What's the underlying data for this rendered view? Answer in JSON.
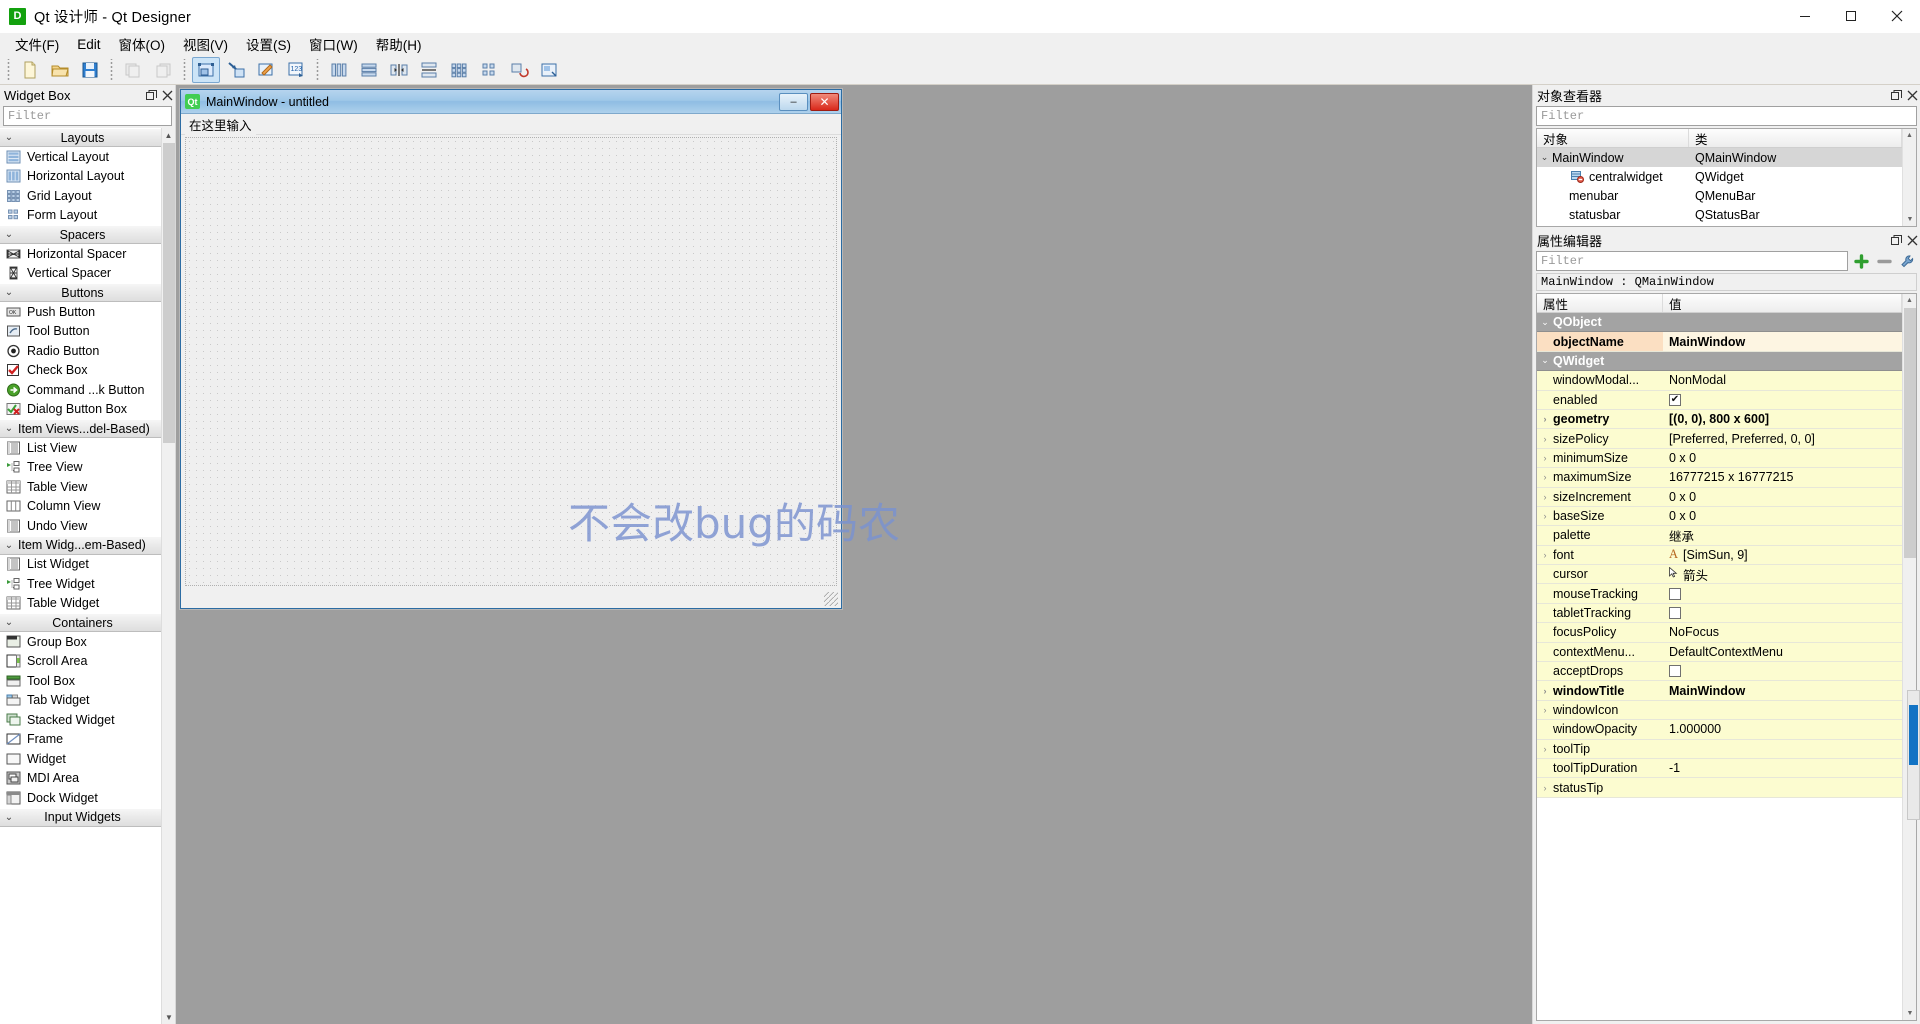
{
  "window": {
    "title": "Qt 设计师 - Qt Designer",
    "app_icon": "D",
    "minimize": "minimize-icon",
    "maximize": "maximize-icon",
    "close": "close-icon"
  },
  "menubar": {
    "items": [
      {
        "label": "文件(F)",
        "mnemonic": "F"
      },
      {
        "label": "Edit",
        "mnemonic": "E"
      },
      {
        "label": "窗体(O)",
        "mnemonic": "O"
      },
      {
        "label": "视图(V)",
        "mnemonic": "V"
      },
      {
        "label": "设置(S)",
        "mnemonic": "S"
      },
      {
        "label": "窗口(W)",
        "mnemonic": "W"
      },
      {
        "label": "帮助(H)",
        "mnemonic": "H"
      }
    ]
  },
  "toolbar": {
    "groups": [
      {
        "name": "file",
        "buttons": [
          {
            "name": "new-form-button",
            "icon": "new-document-icon",
            "state": "enabled"
          },
          {
            "name": "open-form-button",
            "icon": "open-folder-icon",
            "state": "enabled"
          },
          {
            "name": "save-form-button",
            "icon": "save-disk-icon",
            "state": "enabled"
          }
        ]
      },
      {
        "name": "edit",
        "buttons": [
          {
            "name": "undo-button",
            "icon": "undo-icon",
            "state": "disabled"
          },
          {
            "name": "redo-button",
            "icon": "redo-icon",
            "state": "disabled"
          }
        ]
      },
      {
        "name": "mode",
        "buttons": [
          {
            "name": "edit-widgets-button",
            "icon": "edit-widgets-icon",
            "state": "active"
          },
          {
            "name": "edit-signals-slots-button",
            "icon": "signals-slots-icon",
            "state": "enabled"
          },
          {
            "name": "edit-buddies-button",
            "icon": "edit-buddies-icon",
            "state": "enabled"
          },
          {
            "name": "edit-tab-order-button",
            "icon": "tab-order-icon",
            "state": "enabled"
          }
        ]
      },
      {
        "name": "layout",
        "buttons": [
          {
            "name": "layout-horizontally-button",
            "icon": "layout-horizontal-icon",
            "state": "enabled"
          },
          {
            "name": "layout-vertically-button",
            "icon": "layout-vertical-icon",
            "state": "enabled"
          },
          {
            "name": "layout-splitter-horizontal-button",
            "icon": "splitter-horizontal-icon",
            "state": "enabled"
          },
          {
            "name": "layout-splitter-vertical-button",
            "icon": "splitter-vertical-icon",
            "state": "enabled"
          },
          {
            "name": "layout-grid-button",
            "icon": "layout-grid-icon",
            "state": "enabled"
          },
          {
            "name": "layout-form-button",
            "icon": "layout-form-icon",
            "state": "enabled"
          },
          {
            "name": "break-layout-button",
            "icon": "break-layout-icon",
            "state": "enabled"
          },
          {
            "name": "adjust-size-button",
            "icon": "adjust-size-icon",
            "state": "enabled"
          }
        ]
      }
    ]
  },
  "widget_box": {
    "title": "Widget Box",
    "float_icon": "restore-icon",
    "close_icon": "close-icon",
    "filter_placeholder": "Filter",
    "sections": [
      {
        "label": "Layouts",
        "expanded": true,
        "align": "center",
        "items": [
          {
            "label": "Vertical Layout",
            "icon": "vertical-layout-icon"
          },
          {
            "label": "Horizontal Layout",
            "icon": "horizontal-layout-icon"
          },
          {
            "label": "Grid Layout",
            "icon": "grid-layout-icon"
          },
          {
            "label": "Form Layout",
            "icon": "form-layout-icon"
          }
        ]
      },
      {
        "label": "Spacers",
        "expanded": true,
        "align": "center",
        "items": [
          {
            "label": "Horizontal Spacer",
            "icon": "horizontal-spacer-icon"
          },
          {
            "label": "Vertical Spacer",
            "icon": "vertical-spacer-icon"
          }
        ]
      },
      {
        "label": "Buttons",
        "expanded": true,
        "align": "center",
        "items": [
          {
            "label": "Push Button",
            "icon": "push-button-icon"
          },
          {
            "label": "Tool Button",
            "icon": "tool-button-icon"
          },
          {
            "label": "Radio Button",
            "icon": "radio-button-icon"
          },
          {
            "label": "Check Box",
            "icon": "check-box-icon"
          },
          {
            "label": "Command ...k Button",
            "icon": "command-link-button-icon"
          },
          {
            "label": "Dialog Button Box",
            "icon": "dialog-button-box-icon"
          }
        ]
      },
      {
        "label": "Item Views...del-Based)",
        "expanded": true,
        "align": "left",
        "items": [
          {
            "label": "List View",
            "icon": "list-view-icon"
          },
          {
            "label": "Tree View",
            "icon": "tree-view-icon"
          },
          {
            "label": "Table View",
            "icon": "table-view-icon"
          },
          {
            "label": "Column View",
            "icon": "column-view-icon"
          },
          {
            "label": "Undo View",
            "icon": "undo-view-icon"
          }
        ]
      },
      {
        "label": "Item Widg...em-Based)",
        "expanded": true,
        "align": "left",
        "items": [
          {
            "label": "List Widget",
            "icon": "list-widget-icon"
          },
          {
            "label": "Tree Widget",
            "icon": "tree-widget-icon"
          },
          {
            "label": "Table Widget",
            "icon": "table-widget-icon"
          }
        ]
      },
      {
        "label": "Containers",
        "expanded": true,
        "align": "center",
        "items": [
          {
            "label": "Group Box",
            "icon": "group-box-icon"
          },
          {
            "label": "Scroll Area",
            "icon": "scroll-area-icon"
          },
          {
            "label": "Tool Box",
            "icon": "tool-box-icon"
          },
          {
            "label": "Tab Widget",
            "icon": "tab-widget-icon"
          },
          {
            "label": "Stacked Widget",
            "icon": "stacked-widget-icon"
          },
          {
            "label": "Frame",
            "icon": "frame-icon"
          },
          {
            "label": "Widget",
            "icon": "widget-icon"
          },
          {
            "label": "MDI Area",
            "icon": "mdi-area-icon"
          },
          {
            "label": "Dock Widget",
            "icon": "dock-widget-icon"
          }
        ]
      },
      {
        "label": "Input Widgets",
        "expanded": false,
        "align": "center",
        "items": []
      }
    ]
  },
  "form": {
    "title": "MainWindow - untitled",
    "icon_text": "Qt",
    "minimize_label": "–",
    "close_label": "✕",
    "menu_placeholder": "在这里输入"
  },
  "canvas": {
    "watermark": "不会改bug的码农"
  },
  "object_inspector": {
    "title": "对象查看器",
    "float_icon": "restore-icon",
    "close_icon": "close-icon",
    "filter_placeholder": "Filter",
    "columns": [
      "对象",
      "类"
    ],
    "rows": [
      {
        "name": "MainWindow",
        "class": "QMainWindow",
        "indent": 0,
        "expanded": true,
        "selected": true,
        "icon": ""
      },
      {
        "name": "centralwidget",
        "class": "QWidget",
        "indent": 1,
        "expanded": false,
        "selected": false,
        "icon": "central-widget-icon"
      },
      {
        "name": "menubar",
        "class": "QMenuBar",
        "indent": 1,
        "expanded": false,
        "selected": false,
        "icon": ""
      },
      {
        "name": "statusbar",
        "class": "QStatusBar",
        "indent": 1,
        "expanded": false,
        "selected": false,
        "icon": ""
      }
    ]
  },
  "property_editor": {
    "title": "属性编辑器",
    "float_icon": "restore-icon",
    "close_icon": "close-icon",
    "filter_placeholder": "Filter",
    "add_icon": "plus-icon",
    "remove_icon": "minus-icon",
    "config_icon": "wrench-icon",
    "object_line": "MainWindow : QMainWindow",
    "columns": [
      "属性",
      "值"
    ],
    "rows": [
      {
        "kind": "group",
        "name": "QObject",
        "value": "",
        "expandable": true,
        "expanded": true
      },
      {
        "kind": "prop",
        "name": "objectName",
        "value": "MainWindow",
        "tint": "orange",
        "bold": true,
        "expandable": false
      },
      {
        "kind": "group",
        "name": "QWidget",
        "value": "",
        "expandable": true,
        "expanded": true
      },
      {
        "kind": "prop",
        "name": "windowModal...",
        "value": "NonModal",
        "tint": "yellow",
        "bold": false,
        "expandable": false
      },
      {
        "kind": "prop",
        "name": "enabled",
        "value": "",
        "tint": "yellow",
        "bold": false,
        "expandable": false,
        "checkbox": true,
        "checked": true
      },
      {
        "kind": "prop",
        "name": "geometry",
        "value": "[(0, 0), 800 x 600]",
        "tint": "yellow",
        "bold": true,
        "expandable": true
      },
      {
        "kind": "prop",
        "name": "sizePolicy",
        "value": "[Preferred, Preferred, 0, 0]",
        "tint": "yellow",
        "bold": false,
        "expandable": true
      },
      {
        "kind": "prop",
        "name": "minimumSize",
        "value": "0 x 0",
        "tint": "yellow",
        "bold": false,
        "expandable": true
      },
      {
        "kind": "prop",
        "name": "maximumSize",
        "value": "16777215 x 16777215",
        "tint": "yellow",
        "bold": false,
        "expandable": true
      },
      {
        "kind": "prop",
        "name": "sizeIncrement",
        "value": "0 x 0",
        "tint": "yellow",
        "bold": false,
        "expandable": true
      },
      {
        "kind": "prop",
        "name": "baseSize",
        "value": "0 x 0",
        "tint": "yellow",
        "bold": false,
        "expandable": true
      },
      {
        "kind": "prop",
        "name": "palette",
        "value": "继承",
        "tint": "yellow",
        "bold": false,
        "expandable": false
      },
      {
        "kind": "prop",
        "name": "font",
        "value": "[SimSun, 9]",
        "tint": "yellow",
        "bold": false,
        "expandable": true,
        "valueIcon": "font-icon"
      },
      {
        "kind": "prop",
        "name": "cursor",
        "value": "箭头",
        "tint": "yellow",
        "bold": false,
        "expandable": false,
        "valueIcon": "cursor-arrow-icon"
      },
      {
        "kind": "prop",
        "name": "mouseTracking",
        "value": "",
        "tint": "yellow",
        "bold": false,
        "expandable": false,
        "checkbox": true,
        "checked": false
      },
      {
        "kind": "prop",
        "name": "tabletTracking",
        "value": "",
        "tint": "yellow",
        "bold": false,
        "expandable": false,
        "checkbox": true,
        "checked": false
      },
      {
        "kind": "prop",
        "name": "focusPolicy",
        "value": "NoFocus",
        "tint": "yellow",
        "bold": false,
        "expandable": false
      },
      {
        "kind": "prop",
        "name": "contextMenu...",
        "value": "DefaultContextMenu",
        "tint": "yellow",
        "bold": false,
        "expandable": false
      },
      {
        "kind": "prop",
        "name": "acceptDrops",
        "value": "",
        "tint": "yellow",
        "bold": false,
        "expandable": false,
        "checkbox": true,
        "checked": false
      },
      {
        "kind": "prop",
        "name": "windowTitle",
        "value": "MainWindow",
        "tint": "yellow",
        "bold": true,
        "expandable": true
      },
      {
        "kind": "prop",
        "name": "windowIcon",
        "value": "",
        "tint": "yellow",
        "bold": false,
        "expandable": true
      },
      {
        "kind": "prop",
        "name": "windowOpacity",
        "value": "1.000000",
        "tint": "yellow",
        "bold": false,
        "expandable": false
      },
      {
        "kind": "prop",
        "name": "toolTip",
        "value": "",
        "tint": "yellow",
        "bold": false,
        "expandable": true
      },
      {
        "kind": "prop",
        "name": "toolTipDuration",
        "value": "-1",
        "tint": "yellow",
        "bold": false,
        "expandable": false
      },
      {
        "kind": "prop",
        "name": "statusTip",
        "value": "",
        "tint": "yellow",
        "bold": false,
        "expandable": true
      }
    ]
  },
  "colors": {
    "accent": "#1273c4",
    "canvas_bg": "#9e9e9e",
    "group_row": "#a3a3a3",
    "yellow_tint": "#fcfcd0",
    "orange_tint": "#fbdfc2",
    "watermark": "#7a92d0",
    "form_title": "#9fc8e8",
    "close_red": "#d9281a"
  }
}
